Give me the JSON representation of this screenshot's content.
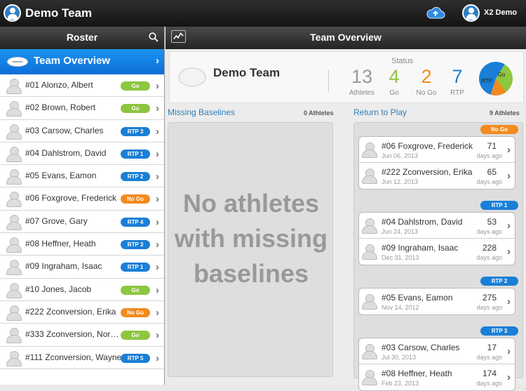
{
  "app": {
    "title": "Demo Team",
    "user_name": "X2 Demo"
  },
  "colors": {
    "go": "#8dc63f",
    "rtp": "#1a7fd6",
    "nogo": "#f28a1e",
    "accent": "#0c6fd8"
  },
  "sidebar": {
    "title": "Roster",
    "overview_label": "Team Overview",
    "items": [
      {
        "name": "#01 Alonzo, Albert",
        "status": "Go",
        "kind": "go"
      },
      {
        "name": "#02 Brown, Robert",
        "status": "Go",
        "kind": "go"
      },
      {
        "name": "#03 Carsow, Charles",
        "status": "RTP 3",
        "kind": "rtp"
      },
      {
        "name": "#04 Dahlstrom, David",
        "status": "RTP 1",
        "kind": "rtp"
      },
      {
        "name": "#05 Evans, Eamon",
        "status": "RTP 2",
        "kind": "rtp"
      },
      {
        "name": "#06 Foxgrove, Frederick",
        "status": "No Go",
        "kind": "nogo"
      },
      {
        "name": "#07 Grove, Gary",
        "status": "RTP 4",
        "kind": "rtp"
      },
      {
        "name": "#08 Heffner, Heath",
        "status": "RTP 3",
        "kind": "rtp"
      },
      {
        "name": "#09 Ingraham, Isaac",
        "status": "RTP 1",
        "kind": "rtp"
      },
      {
        "name": "#10 Jones, Jacob",
        "status": "Go",
        "kind": "go"
      },
      {
        "name": "#222 Zconversion, Erika",
        "status": "No Go",
        "kind": "nogo"
      },
      {
        "name": "#333 Zconversion, Nor…",
        "status": "Go",
        "kind": "go"
      },
      {
        "name": "#111 Zconversion, Wayne",
        "status": "RTP 5",
        "kind": "rtp"
      }
    ]
  },
  "main": {
    "title": "Team Overview",
    "summary": {
      "team": "Demo Team",
      "status_label": "Status",
      "stats": [
        {
          "value": "13",
          "label": "Athletes",
          "color": "#999999"
        },
        {
          "value": "4",
          "label": "Go",
          "color": "#8dc63f"
        },
        {
          "value": "2",
          "label": "No Go",
          "color": "#f28a1e"
        },
        {
          "value": "7",
          "label": "RTP",
          "color": "#1a7fd6"
        }
      ],
      "pie": {
        "labels": [
          "Go",
          "RTP"
        ],
        "values": [
          4,
          2,
          7
        ]
      }
    },
    "missing": {
      "title": "Missing Baselines",
      "count": "0 Athletes",
      "empty_message": "No athletes with missing baselines"
    },
    "rtp": {
      "title": "Return to Play",
      "count": "9 Athletes",
      "groups": [
        {
          "label": "No Go",
          "kind": "nogo",
          "rows": [
            {
              "name": "#06 Foxgrove, Frederick",
              "date": "Jun 06, 2013",
              "days": "71",
              "ago": "days ago"
            },
            {
              "name": "#222 Zconversion, Erika",
              "date": "Jun 12, 2013",
              "days": "65",
              "ago": "days ago"
            }
          ]
        },
        {
          "label": "RTP 1",
          "kind": "rtp",
          "rows": [
            {
              "name": "#04 Dahlstrom, David",
              "date": "Jun 24, 2013",
              "days": "53",
              "ago": "days ago"
            },
            {
              "name": "#09 Ingraham, Isaac",
              "date": "Dec 31, 2013",
              "days": "228",
              "ago": "days ago"
            }
          ]
        },
        {
          "label": "RTP 2",
          "kind": "rtp",
          "rows": [
            {
              "name": "#05 Evans, Eamon",
              "date": "Nov 14, 2012",
              "days": "275",
              "ago": "days ago"
            }
          ]
        },
        {
          "label": "RTP 3",
          "kind": "rtp",
          "rows": [
            {
              "name": "#03 Carsow, Charles",
              "date": "Jul 30, 2013",
              "days": "17",
              "ago": "days ago"
            },
            {
              "name": "#08 Heffner, Heath",
              "date": "Feb 23, 2013",
              "days": "174",
              "ago": "days ago"
            }
          ]
        }
      ]
    }
  }
}
